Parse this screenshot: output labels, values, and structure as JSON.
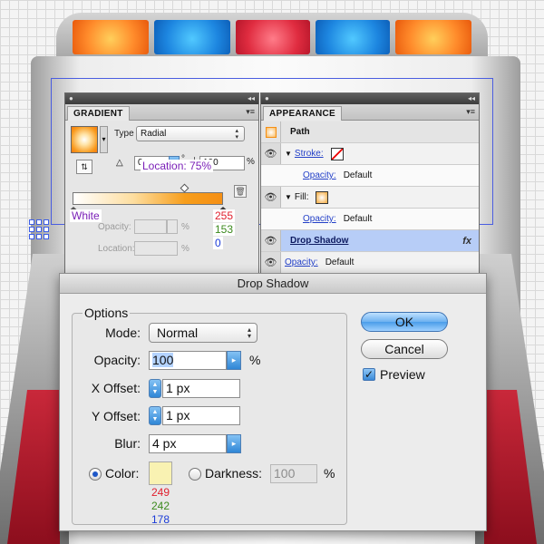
{
  "colors": {
    "gradient_end": "#f58f14",
    "shadow_color": "#f9f2b2",
    "annotation_red": "#e0202e",
    "annotation_green": "#3c8a1e",
    "annotation_blue": "#1b3bd8",
    "annotation_purple": "#7a1fb7"
  },
  "gradient_panel": {
    "tab": "GRADIENT",
    "type_label": "Type",
    "type_value": "Radial",
    "angle_value": "0",
    "aspect_value": "100",
    "percent_sign": "%",
    "degree_sign": "°",
    "opacity_label": "Opacity:",
    "location_label": "Location:",
    "icons": [
      "swatch-dropdown",
      "reverse-gradient",
      "angle",
      "aspect-ratio",
      "delete-stop"
    ]
  },
  "appearance_panel": {
    "tab": "APPEARANCE",
    "path_label": "Path",
    "stroke_label": "Stroke:",
    "fill_label": "Fill:",
    "opacity_link": "Opacity:",
    "default_value": "Default",
    "drop_shadow": "Drop Shadow",
    "fx": "fx"
  },
  "annotations": {
    "location": "Location: 75%",
    "white": "White",
    "stop_r": "255",
    "stop_g": "153",
    "stop_b": "0",
    "shadow_r": "249",
    "shadow_g": "242",
    "shadow_b": "178"
  },
  "dialog": {
    "title": "Drop Shadow",
    "options_label": "Options",
    "mode_label": "Mode:",
    "mode_value": "Normal",
    "opacity_label": "Opacity:",
    "opacity_value": "100",
    "percent": "%",
    "x_offset_label": "X Offset:",
    "x_offset_value": "1 px",
    "y_offset_label": "Y Offset:",
    "y_offset_value": "1 px",
    "blur_label": "Blur:",
    "blur_value": "4 px",
    "color_label": "Color:",
    "color_selected": true,
    "darkness_label": "Darkness:",
    "darkness_value": "100",
    "darkness_percent": "%",
    "ok": "OK",
    "cancel": "Cancel",
    "preview_label": "Preview",
    "preview_checked": true
  }
}
